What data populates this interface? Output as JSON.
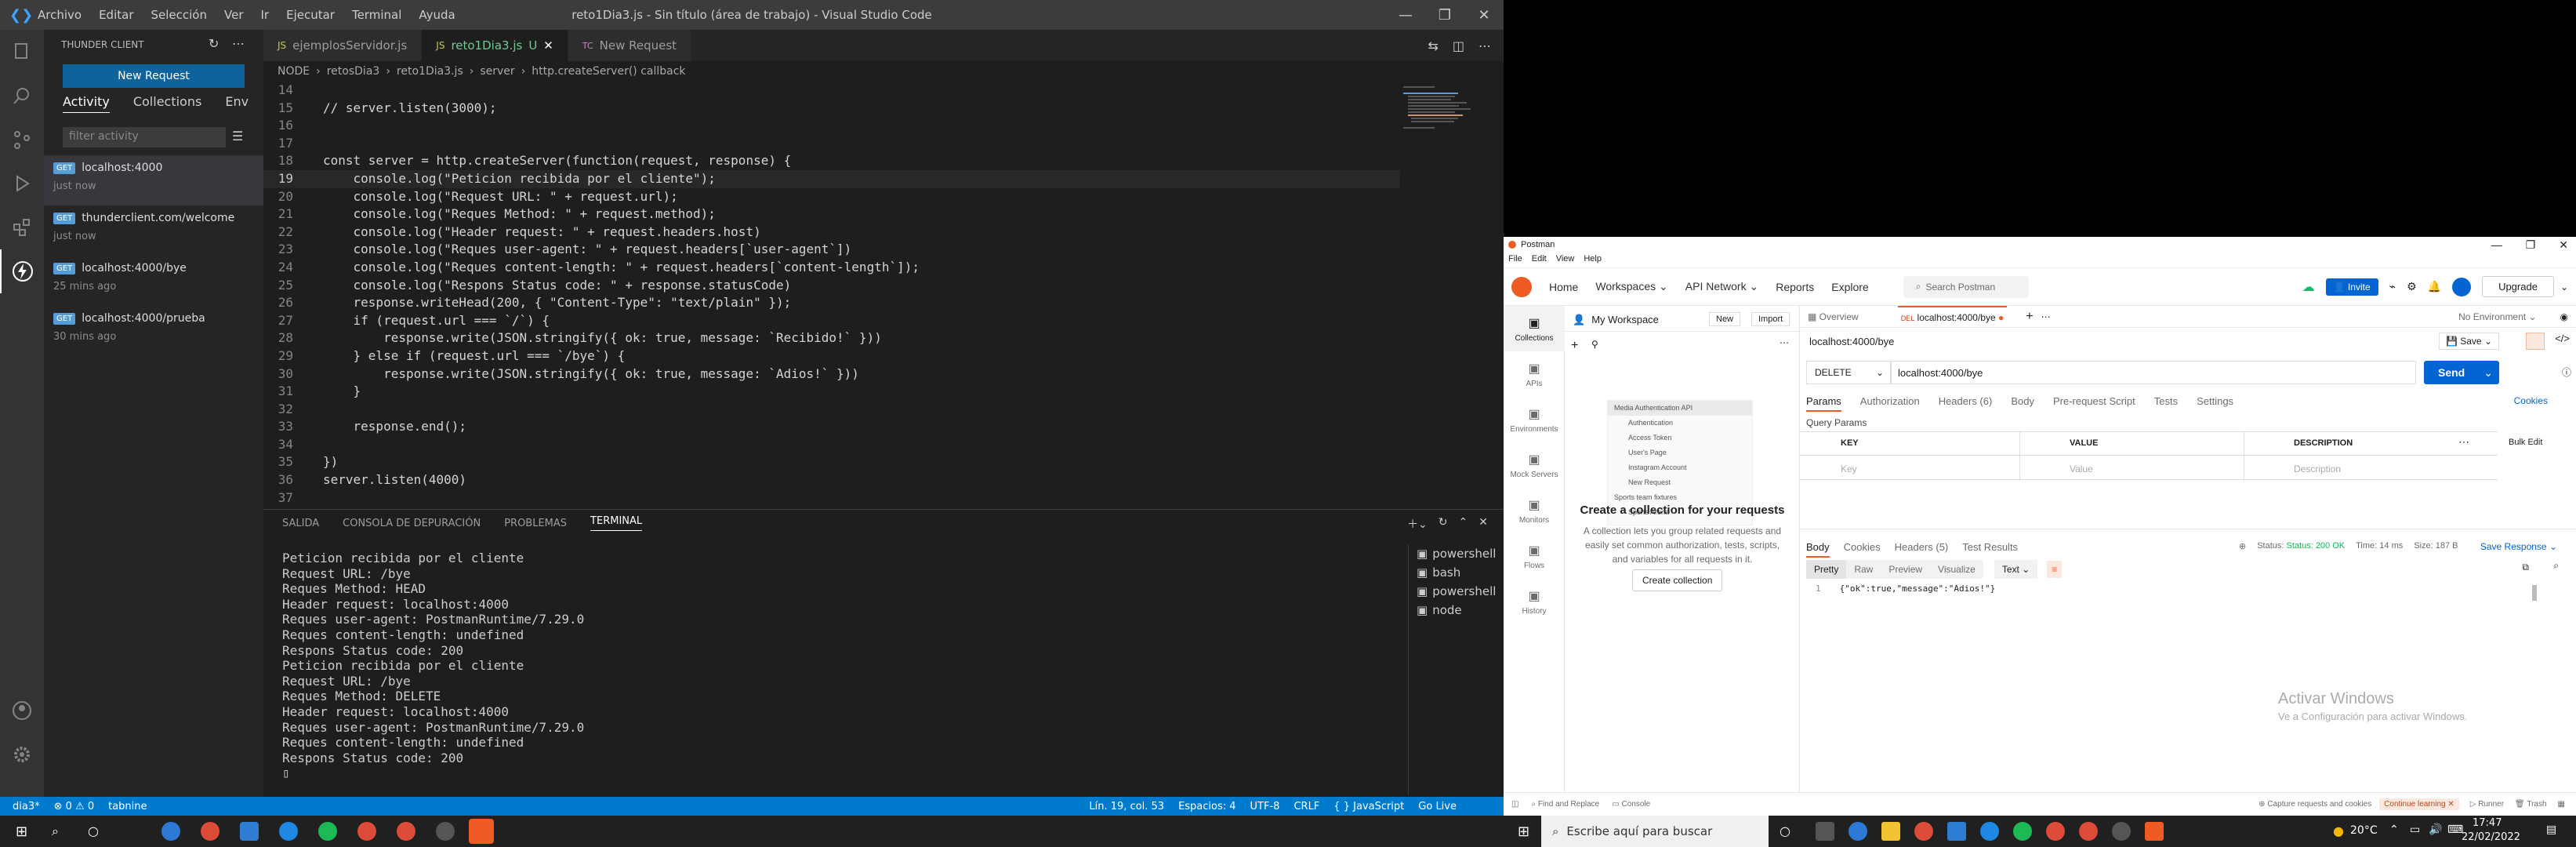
{
  "vscode": {
    "menu": [
      "Archivo",
      "Editar",
      "Selección",
      "Ver",
      "Ir",
      "Ejecutar",
      "Terminal",
      "Ayuda"
    ],
    "title": "reto1Dia3.js - Sin título (área de trabajo) - Visual Studio Code",
    "sidebar": {
      "header": "THUNDER CLIENT",
      "new_request": "New Request",
      "tabs": [
        "Activity",
        "Collections",
        "Env"
      ],
      "filter_placeholder": "filter activity",
      "items": [
        {
          "method": "GET",
          "url": "localhost:4000",
          "time": "just now"
        },
        {
          "method": "GET",
          "url": "thunderclient.com/welcome",
          "time": "just now"
        },
        {
          "method": "GET",
          "url": "localhost:4000/bye",
          "time": "25 mins ago"
        },
        {
          "method": "GET",
          "url": "localhost:4000/prueba",
          "time": "30 mins ago"
        }
      ]
    },
    "tabs": [
      "ejemplosServidor.js",
      "reto1Dia3.js",
      "New Request"
    ],
    "tab_badge": "TC",
    "tab_mod": "U",
    "breadcrumb": [
      "NODE",
      "retosDia3",
      "reto1Dia3.js",
      "server",
      "http.createServer() callback"
    ],
    "code": [
      {
        "n": "14",
        "t": ""
      },
      {
        "n": "15",
        "t": "// server.listen(3000);"
      },
      {
        "n": "16",
        "t": ""
      },
      {
        "n": "17",
        "t": ""
      },
      {
        "n": "18",
        "t": "const server = http.createServer(function(request, response) {"
      },
      {
        "n": "19",
        "t": "    console.log(\"Peticion recibida por el cliente\");"
      },
      {
        "n": "20",
        "t": "    console.log(\"Request URL: \" + request.url);"
      },
      {
        "n": "21",
        "t": "    console.log(\"Reques Method: \" + request.method);"
      },
      {
        "n": "22",
        "t": "    console.log(\"Header request: \" + request.headers.host)"
      },
      {
        "n": "23",
        "t": "    console.log(\"Reques user-agent: \" + request.headers[`user-agent`])"
      },
      {
        "n": "24",
        "t": "    console.log(\"Reques content-length: \" + request.headers[`content-length`]);"
      },
      {
        "n": "25",
        "t": "    console.log(\"Respons Status code: \" + response.statusCode)"
      },
      {
        "n": "26",
        "t": "    response.writeHead(200, { \"Content-Type\": \"text/plain\" });"
      },
      {
        "n": "27",
        "t": "    if (request.url === `/`) {"
      },
      {
        "n": "28",
        "t": "        response.write(JSON.stringify({ ok: true, message: `Recibido!` }))"
      },
      {
        "n": "29",
        "t": "    } else if (request.url === `/bye`) {"
      },
      {
        "n": "30",
        "t": "        response.write(JSON.stringify({ ok: true, message: `Adios!` }))"
      },
      {
        "n": "31",
        "t": "    }"
      },
      {
        "n": "32",
        "t": ""
      },
      {
        "n": "33",
        "t": "    response.end();"
      },
      {
        "n": "34",
        "t": ""
      },
      {
        "n": "35",
        "t": "})"
      },
      {
        "n": "36",
        "t": "server.listen(4000)"
      },
      {
        "n": "37",
        "t": ""
      }
    ],
    "panel_tabs": [
      "SALIDA",
      "CONSOLA DE DEPURACIÓN",
      "PROBLEMAS",
      "TERMINAL"
    ],
    "terminal": [
      "Peticion recibida por el cliente",
      "Request URL: /bye",
      "Reques Method: HEAD",
      "Header request: localhost:4000",
      "Reques user-agent: PostmanRuntime/7.29.0",
      "Reques content-length: undefined",
      "Respons Status code: 200",
      "Peticion recibida por el cliente",
      "Request URL: /bye",
      "Reques Method: DELETE",
      "Header request: localhost:4000",
      "Reques user-agent: PostmanRuntime/7.29.0",
      "Reques content-length: undefined",
      "Respons Status code: 200"
    ],
    "terminal_list": [
      "powershell",
      "bash",
      "powershell",
      "node"
    ],
    "status_left": [
      "dia3*",
      "⊗ 0 ⚠ 0",
      "tabnine"
    ],
    "status_right": [
      "Lín. 19, col. 53",
      "Espacios: 4",
      "UTF-8",
      "CRLF",
      "{ } JavaScript",
      "Go Live"
    ]
  },
  "postman": {
    "title": "Postman",
    "menu": [
      "File",
      "Edit",
      "View",
      "Help"
    ],
    "nav": [
      "Home",
      "Workspaces",
      "API Network",
      "Reports",
      "Explore"
    ],
    "search": "Search Postman",
    "invite": "Invite",
    "upgrade": "Upgrade",
    "workspace": "My Workspace",
    "new": "New",
    "import": "Import",
    "rail": [
      "Collections",
      "APIs",
      "Environments",
      "Mock Servers",
      "Monitors",
      "Flows",
      "History"
    ],
    "tree": [
      "Media Authentication API",
      "Authentication",
      "Access Token",
      "User's Page",
      "Instagram Account",
      "New Request",
      "Sports team fixtures",
      "Sports Arena"
    ],
    "empty_title": "Create a collection for your requests",
    "empty_text": [
      "A collection lets you group related requests and",
      "easily set common authorization, tests, scripts,",
      "and variables for all requests in it."
    ],
    "create_collection": "Create collection",
    "tabs": [
      "Overview",
      "localhost:4000/bye"
    ],
    "environment": "No Environment",
    "req_name": "localhost:4000/bye",
    "save": "Save",
    "method": "DELETE",
    "url": "localhost:4000/bye",
    "send": "Send",
    "req_tabs": [
      "Params",
      "Authorization",
      "Headers (6)",
      "Body",
      "Pre-request Script",
      "Tests",
      "Settings"
    ],
    "cookies": "Cookies",
    "query_params": "Query Params",
    "cols": [
      "KEY",
      "VALUE",
      "DESCRIPTION"
    ],
    "bulk_edit": "Bulk Edit",
    "placeholders": [
      "Key",
      "Value",
      "Description"
    ],
    "resp_tabs": [
      "Body",
      "Cookies",
      "Headers (5)",
      "Test Results"
    ],
    "status": "Status: 200 OK",
    "time": "Time: 14 ms",
    "size": "Size: 187 B",
    "save_response": "Save Response",
    "view_tabs": [
      "Pretty",
      "Raw",
      "Preview",
      "Visualize"
    ],
    "format": "Text",
    "resp_line": "1",
    "response_body": "{\"ok\":true,\"message\":\"Adios!\"}",
    "watermark1": "Activar Windows",
    "watermark2": "Ve a Configuración para activar Windows.",
    "footer_left": [
      "Find and Replace",
      "Console"
    ],
    "footer_right": [
      "Capture requests and cookies",
      "Continue learning",
      "Runner",
      "Trash"
    ]
  },
  "taskbar": {
    "search": "Escribe aquí para buscar",
    "temp": "20°C",
    "time": "17:47",
    "date": "22/02/2022"
  }
}
